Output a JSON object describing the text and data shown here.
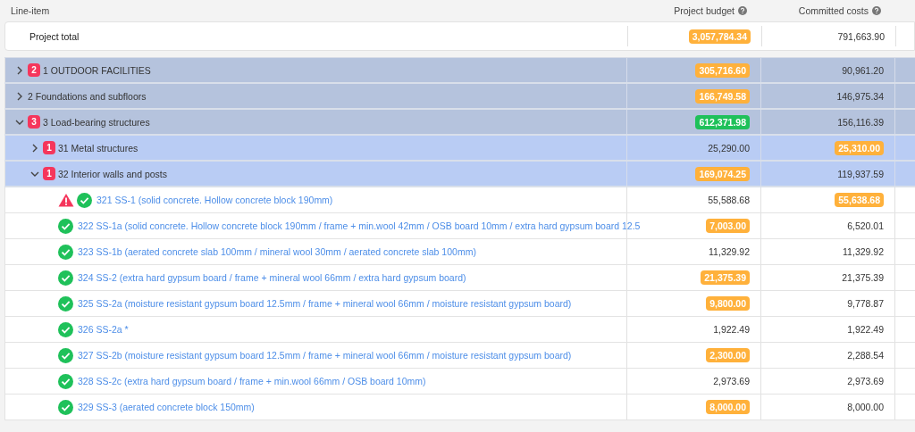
{
  "header": {
    "columns": [
      {
        "label": "Line-item"
      },
      {
        "label": "Project budget",
        "help": true
      },
      {
        "label": "Committed costs",
        "help": true
      }
    ]
  },
  "project_total": {
    "label": "Project total",
    "budget": {
      "text": "3,057,784.34",
      "color": "#ffb13b"
    },
    "committed": {
      "text": "791,663.90"
    }
  },
  "tree": [
    {
      "label": "1 OUTDOOR FACILITIES",
      "badge": "2",
      "expanded": false,
      "budget": {
        "text": "305,716.60",
        "color": "#ffb13b"
      },
      "committed": {
        "text": "90,961.20"
      }
    },
    {
      "label": "2 Foundations and subfloors",
      "expanded": false,
      "budget": {
        "text": "166,749.58",
        "color": "#ffb13b"
      },
      "committed": {
        "text": "146,975.34"
      }
    },
    {
      "label": "3 Load-bearing structures",
      "badge": "3",
      "expanded": true,
      "budget": {
        "text": "612,371.98",
        "color": "#1fc15a"
      },
      "committed": {
        "text": "156,116.39"
      },
      "children": [
        {
          "label": "31 Metal structures",
          "badge": "1",
          "expanded": false,
          "budget": {
            "text": "25,290.00"
          },
          "committed": {
            "text": "25,310.00",
            "color": "#ffb13b"
          }
        },
        {
          "label": "32 Interior walls and posts",
          "badge": "1",
          "expanded": true,
          "budget": {
            "text": "169,074.25",
            "color": "#ffb13b"
          },
          "committed": {
            "text": "119,937.59"
          },
          "children": [
            {
              "label": "321 SS-1 (solid concrete. Hollow concrete block 190mm)",
              "warning": true,
              "approved": true,
              "budget": {
                "text": "55,588.68"
              },
              "committed": {
                "text": "55,638.68",
                "color": "#ffb13b"
              }
            },
            {
              "label": "322 SS-1a (solid concrete. Hollow concrete block 190mm / frame + min.wool 42mm / OSB board 10mm / extra hard gypsum board 12.5",
              "approved": true,
              "budget": {
                "text": "7,003.00",
                "color": "#ffb13b"
              },
              "committed": {
                "text": "6,520.01"
              }
            },
            {
              "label": "323 SS-1b (aerated concrete slab 100mm / mineral wool 30mm / aerated concrete slab 100mm)",
              "approved": true,
              "budget": {
                "text": "11,329.92"
              },
              "committed": {
                "text": "11,329.92"
              }
            },
            {
              "label": "324 SS-2 (extra hard gypsum board / frame + mineral wool 66mm / extra hard gypsum board)",
              "approved": true,
              "budget": {
                "text": "21,375.39",
                "color": "#ffb13b"
              },
              "committed": {
                "text": "21,375.39"
              }
            },
            {
              "label": "325 SS-2a (moisture resistant gypsum board 12.5mm / frame + mineral wool 66mm / moisture resistant gypsum board)",
              "approved": true,
              "budget": {
                "text": "9,800.00",
                "color": "#ffb13b"
              },
              "committed": {
                "text": "9,778.87"
              }
            },
            {
              "label": "326 SS-2a *",
              "approved": true,
              "budget": {
                "text": "1,922.49"
              },
              "committed": {
                "text": "1,922.49"
              }
            },
            {
              "label": "327 SS-2b (moisture resistant gypsum board 12.5mm / frame + mineral wool 66mm / moisture resistant gypsum board)",
              "approved": true,
              "budget": {
                "text": "2,300.00",
                "color": "#ffb13b"
              },
              "committed": {
                "text": "2,288.54"
              }
            },
            {
              "label": "328 SS-2c (extra hard gypsum board / frame + min.wool 66mm / OSB board 10mm)",
              "approved": true,
              "budget": {
                "text": "2,973.69"
              },
              "committed": {
                "text": "2,973.69"
              }
            },
            {
              "label": "329 SS-3 (aerated concrete block 150mm)",
              "approved": true,
              "budget": {
                "text": "8,000.00",
                "color": "#ffb13b"
              },
              "committed": {
                "text": "8,000.00"
              }
            }
          ]
        }
      ]
    }
  ]
}
